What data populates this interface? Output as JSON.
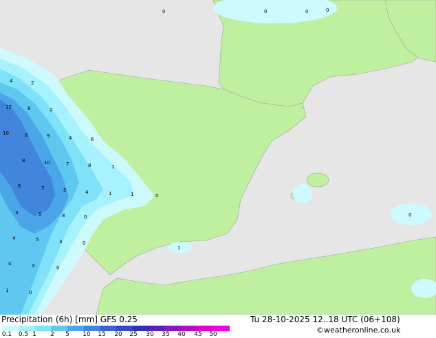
{
  "colors": {
    "sea": "#e6e6e6",
    "land": "#bff0a0",
    "border": "#a0a0a0",
    "precip": [
      "#ccfaff",
      "#a6f2ff",
      "#80e2f8",
      "#5ec8f0",
      "#4aa6e6",
      "#3f86dc",
      "#3a64d2"
    ]
  },
  "map_labels": [
    {
      "text": "4"
    },
    {
      "text": "2"
    },
    {
      "text": "12"
    },
    {
      "text": "8"
    },
    {
      "text": "2"
    },
    {
      "text": "10"
    },
    {
      "text": "8"
    },
    {
      "text": "9"
    },
    {
      "text": "4"
    },
    {
      "text": "6"
    },
    {
      "text": "8"
    },
    {
      "text": "10"
    },
    {
      "text": "7"
    },
    {
      "text": "8"
    },
    {
      "text": "1"
    },
    {
      "text": "6"
    },
    {
      "text": "7"
    },
    {
      "text": "5"
    },
    {
      "text": "4"
    },
    {
      "text": "1"
    },
    {
      "text": "1"
    },
    {
      "text": "0"
    },
    {
      "text": "3"
    },
    {
      "text": "5"
    },
    {
      "text": "8"
    },
    {
      "text": "0"
    },
    {
      "text": "4"
    },
    {
      "text": "5"
    },
    {
      "text": "3"
    },
    {
      "text": "0"
    },
    {
      "text": "4"
    },
    {
      "text": "3"
    },
    {
      "text": "0"
    },
    {
      "text": "1"
    },
    {
      "text": "0"
    },
    {
      "text": "1"
    },
    {
      "text": "0"
    },
    {
      "text": "0"
    },
    {
      "text": "0"
    },
    {
      "text": "0"
    },
    {
      "text": "0"
    }
  ],
  "footer": {
    "title": "Precipitation (6h) [mm] GFS 0.25",
    "datetime": "Tu 28-10-2025 12..18 UTC (06+108)",
    "credit": "©weatheronline.co.uk",
    "scale_ticks": [
      "0.1",
      "0.5",
      "1",
      "2",
      "5",
      "10",
      "15",
      "20",
      "25",
      "30",
      "35",
      "40",
      "45",
      "50"
    ],
    "scale_colors": [
      "#ccfaff",
      "#a6f2ff",
      "#80e2f8",
      "#5ec8f0",
      "#4aa6e6",
      "#3f86dc",
      "#3a64d2",
      "#3448c8",
      "#3030b4",
      "#5a20b4",
      "#8c14c0",
      "#b40ac8",
      "#dc00d2",
      "#f000e6"
    ]
  }
}
